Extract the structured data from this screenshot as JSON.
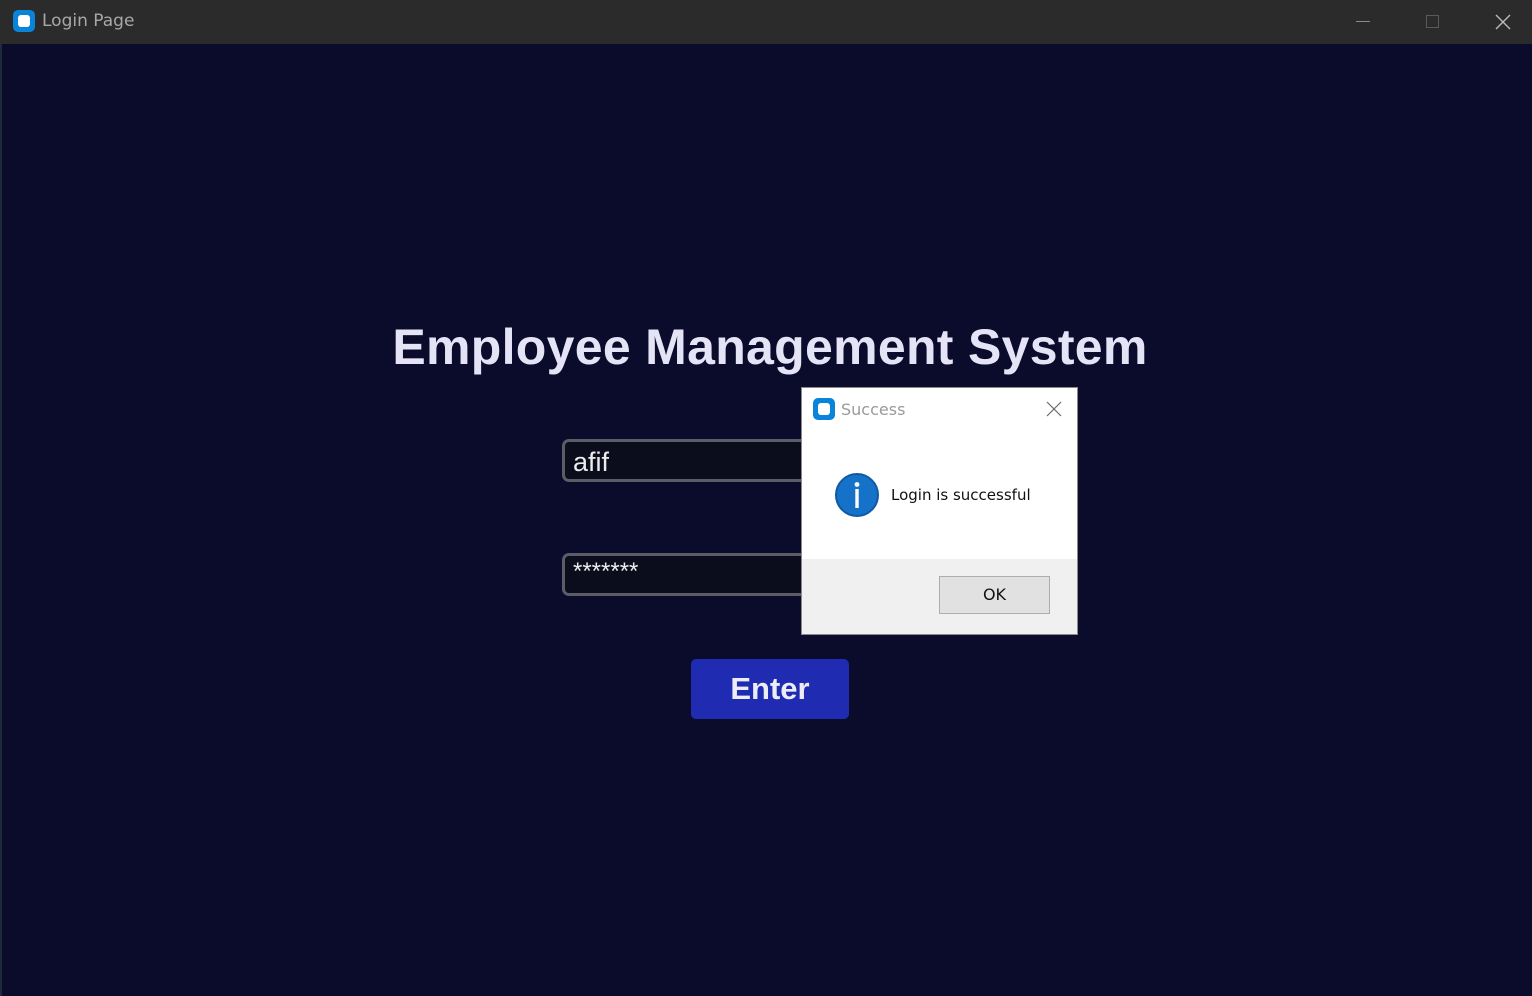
{
  "window": {
    "title": "Login Page",
    "app_icon": "app-icon"
  },
  "main": {
    "heading": "Employee Management System",
    "username_value": "afif",
    "password_value": "*******",
    "enter_label": "Enter"
  },
  "dialog": {
    "title": "Success",
    "icon": "info-icon",
    "message": "Login is successful",
    "ok_label": "OK"
  },
  "colors": {
    "background": "#0b0c2b",
    "titlebar": "#2b2b2b",
    "enter_button": "#1f2bb0",
    "info_icon": "#1672c9",
    "app_icon": "#0a84d8"
  }
}
